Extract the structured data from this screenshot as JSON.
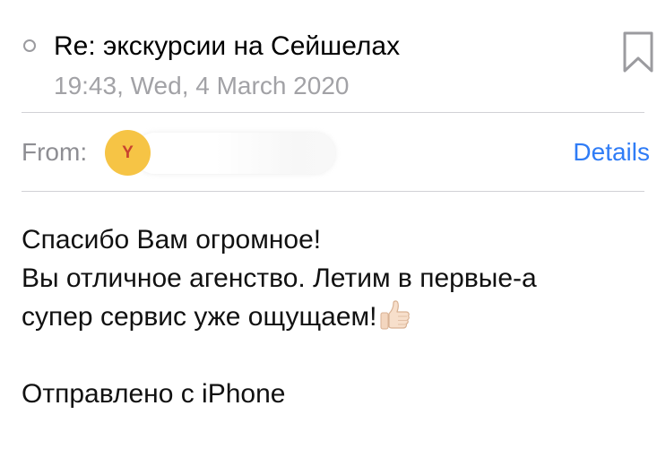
{
  "message": {
    "subject": "Re: экскурсии на Сейшелах",
    "date": "19:43, Wed, 4 March 2020",
    "from_label": "From:",
    "sender_initial": "Y",
    "details_label": "Details",
    "body_lines": [
      "Спасибо Вам огромное!",
      "Вы отличное агенство. Летим в первые-а",
      "супер сервис уже ощущаем!"
    ],
    "signature": "Отправлено с iPhone"
  },
  "icons": {
    "unread": "unread-dot-icon",
    "bookmark": "bookmark-icon",
    "emoji": "thumbs-up-icon"
  },
  "colors": {
    "accent": "#2f7cf6",
    "avatar_bg": "#f6c445",
    "avatar_fg": "#c8432f",
    "secondary_text": "#a2a2a6",
    "divider": "#d1d1d6"
  }
}
